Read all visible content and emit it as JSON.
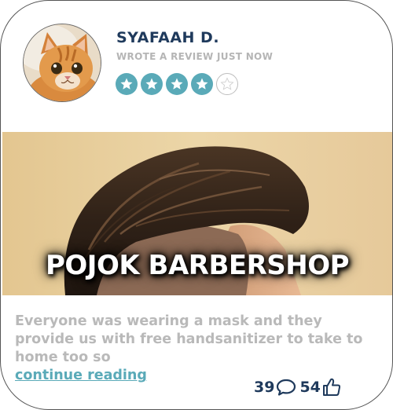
{
  "review": {
    "reviewer_name": "SYAFAAH D.",
    "meta": "WROTE A REVIEW JUST NOW",
    "rating": 4,
    "rating_max": 5,
    "place_name": "POJOK BARBERSHOP",
    "text": "Everyone was wearing a mask and they provide us with free handsanitizer to take to home too so",
    "read_more_label": "continue reading",
    "comment_count": "39",
    "like_count": "54"
  },
  "icons": {
    "avatar": "cat-avatar",
    "star": "star-icon",
    "comment": "comment-bubble-icon",
    "like": "thumbs-up-icon"
  },
  "colors": {
    "accent": "#5aaab8",
    "name": "#1f3a5c",
    "muted": "#b9b9b9"
  }
}
